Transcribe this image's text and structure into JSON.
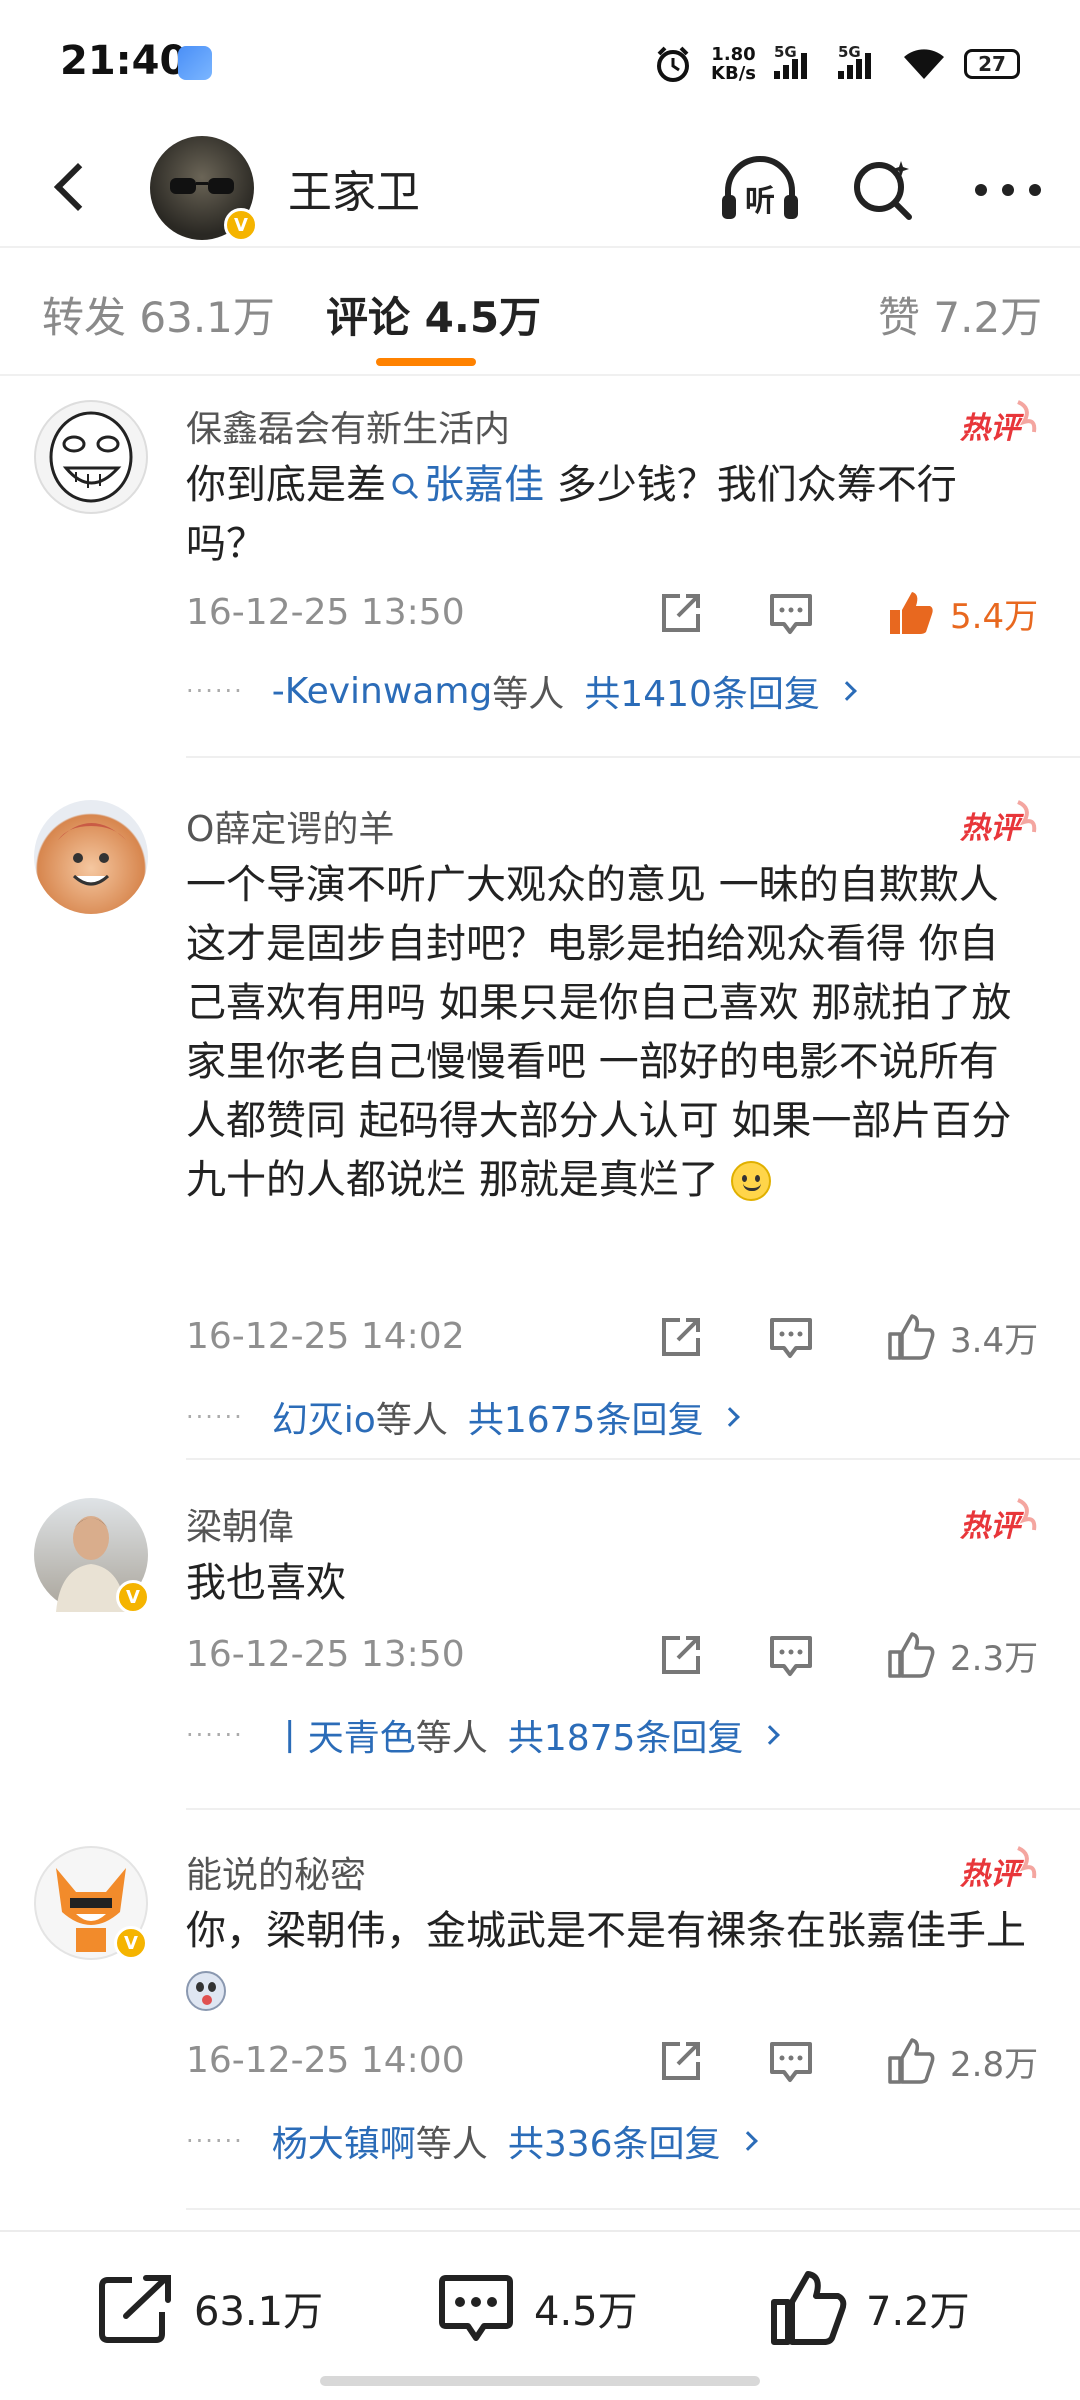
{
  "status_bar": {
    "time": "21:40",
    "net_speed_value": "1.80",
    "net_speed_unit": "KB/s",
    "sim1": "5G",
    "sim2": "5G",
    "battery": "27"
  },
  "header": {
    "user_name": "王家卫",
    "icons": [
      "listen-icon",
      "search-icon",
      "more-icon"
    ],
    "listen_label": "听"
  },
  "tabs": [
    {
      "label": "转发",
      "count": "63.1万",
      "active": false
    },
    {
      "label": "评论",
      "count": "4.5万",
      "active": true
    },
    {
      "label": "赞",
      "count": "7.2万",
      "active": false
    }
  ],
  "hot_label": "热评",
  "comments": [
    {
      "user": "保鑫磊会有新生活内",
      "text_before": "你到底是差",
      "mention": "张嘉佳",
      "text_after": " 多少钱？我们众筹不行吗？",
      "time": "16-12-25 13:50",
      "likes": "5.4万",
      "liked": true,
      "reply_users": "-Kevinwamg",
      "reply_suffix": "等人",
      "reply_count": "共1410条回复"
    },
    {
      "user": "O薛定谔的羊",
      "text": "一个导演不听广大观众的意见 一昧的自欺欺人 这才是固步自封吧？电影是拍给观众看得 你自己喜欢有用吗 如果只是你自己喜欢 那就拍了放家里你老自己慢慢看吧 一部好的电影不说所有人都赞同 起码得大部分人认可 如果一部片百分九十的人都说烂 那就是真烂了",
      "time": "16-12-25 14:02",
      "likes": "3.4万",
      "liked": false,
      "reply_users": "幻灭io",
      "reply_suffix": "等人",
      "reply_count": "共1675条回复"
    },
    {
      "user": "梁朝偉",
      "text": "我也喜欢",
      "time": "16-12-25 13:50",
      "likes": "2.3万",
      "liked": false,
      "reply_users": "丨天青色",
      "reply_suffix": "等人",
      "reply_count": "共1875条回复"
    },
    {
      "user": "能说的秘密",
      "text": "你，梁朝伟，金城武是不是有裸条在张嘉佳手上",
      "time": "16-12-25 14:00",
      "likes": "2.8万",
      "liked": false,
      "reply_users": "杨大镇啊",
      "reply_suffix": "等人",
      "reply_count": "共336条回复"
    }
  ],
  "bottom_bar": {
    "repost_count": "63.1万",
    "comment_count": "4.5万",
    "like_count": "7.2万"
  },
  "colors": {
    "accent": "#ff8200",
    "link": "#2b6cb8",
    "hot": "#e8363a",
    "liked": "#e8681f",
    "verify": "#f5b400"
  }
}
